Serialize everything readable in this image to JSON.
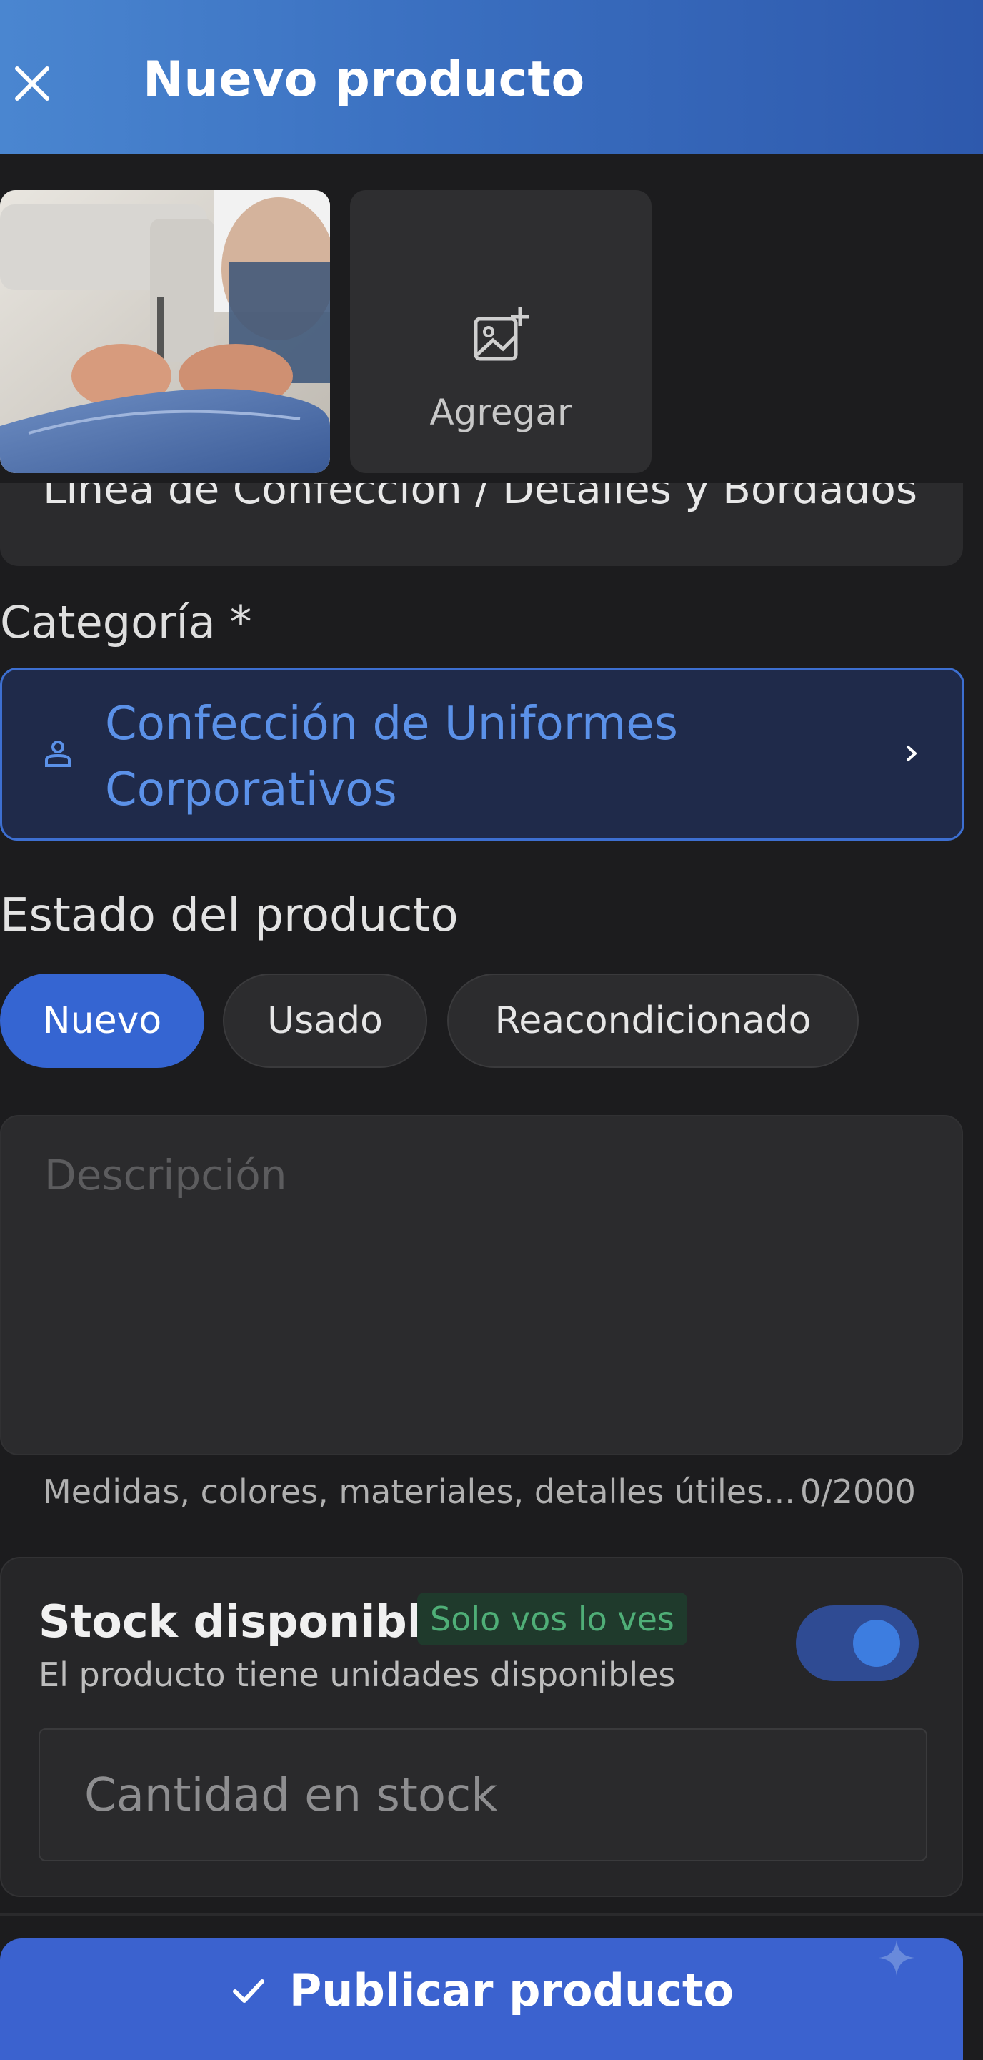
{
  "header": {
    "title": "Nuevo producto",
    "close_icon": "close-icon"
  },
  "photos": {
    "add_label": "Agregar",
    "thumbnail_description": "sewing machine photo",
    "add_icon": "add-photo-icon"
  },
  "title_field": {
    "value": "Línea de Confección / Detalles y Bordados"
  },
  "category": {
    "label": "Categoría *",
    "value": "Confección de Uniformes Corporativos",
    "icon": "sewing-user-icon",
    "accent": "#5b91e8"
  },
  "state": {
    "label": "Estado del producto",
    "options": [
      "Nuevo",
      "Usado",
      "Reacondicionado"
    ],
    "selected": "Nuevo"
  },
  "description": {
    "placeholder": "Descripción",
    "hint": "Medidas, colores, materiales, detalles útiles...",
    "count": "0/2000"
  },
  "stock": {
    "title": "Stock disponible",
    "badge": "Solo vos lo ves",
    "subtitle": "El producto tiene unidades disponibles",
    "toggle_on": true,
    "quantity_placeholder": "Cantidad en stock"
  },
  "publish": {
    "label": "Publicar producto",
    "color": "#3b62cf"
  }
}
